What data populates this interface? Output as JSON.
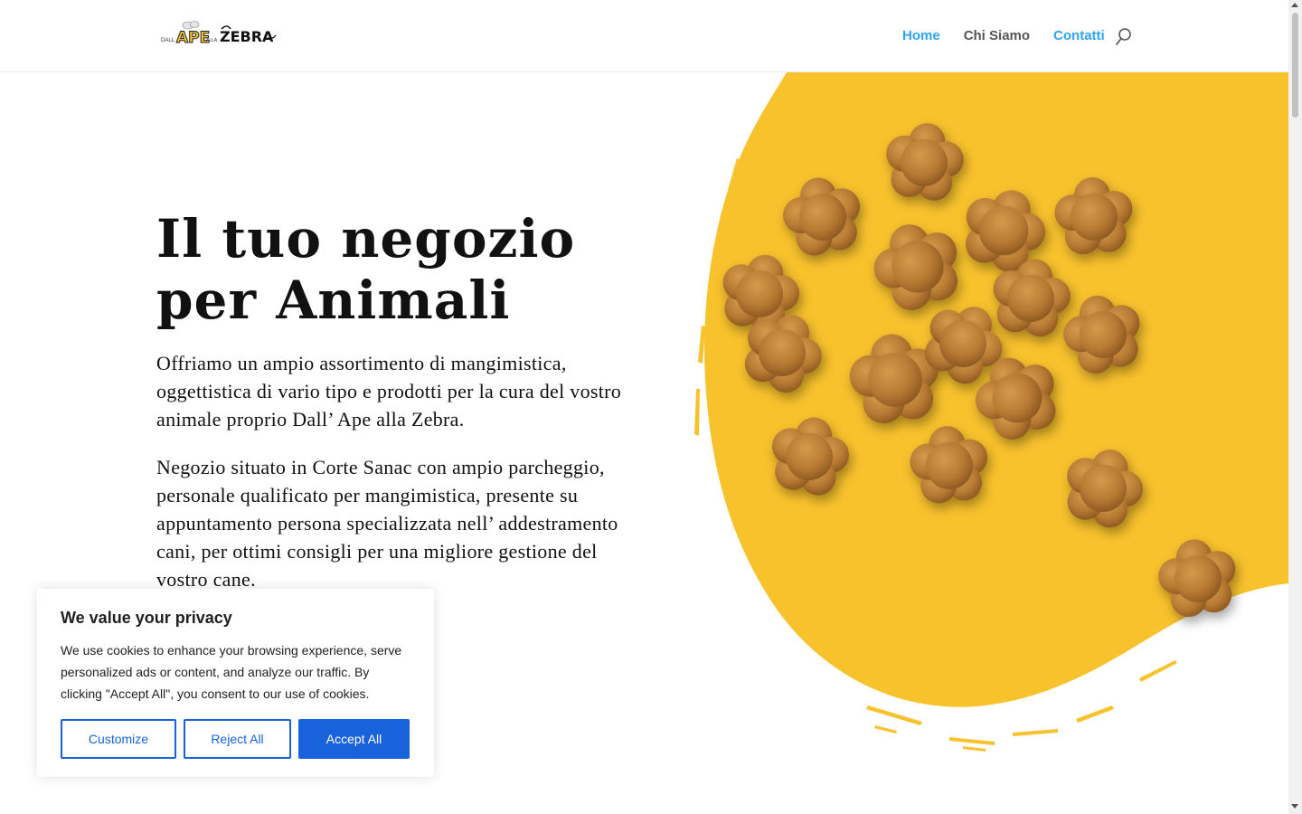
{
  "header": {
    "logo_text": "Dall'Ape alla Zebra",
    "nav": [
      {
        "label": "Home",
        "active": true
      },
      {
        "label": "Chi Siamo",
        "active": false
      },
      {
        "label": "Contatti",
        "active": true
      }
    ],
    "search_icon": "search-icon"
  },
  "hero": {
    "title_line1": "Il tuo negozio",
    "title_line2": "per Animali",
    "paragraph1": "Offriamo un ampio assortimento di mangimistica, oggettistica di vario tipo e prodotti per la cura del vostro animale proprio Dall’ Ape alla Zebra.",
    "paragraph2": "Negozio situato in Corte Sanac con ampio parcheggio, personale qualificato per mangimistica, presente su appuntamento persona specializzata nell’ addestramento cani, per ottimi consigli per una migliore gestione del vostro cane.",
    "image": "dog-biscuits-on-yellow-splash"
  },
  "cookie_banner": {
    "title": "We value your privacy",
    "text": "We use cookies to enhance your browsing experience, serve personalized ads or content, and analyze our traffic. By clicking \"Accept All\", you consent to our use of cookies.",
    "customize_label": "Customize",
    "reject_label": "Reject All",
    "accept_label": "Accept All"
  },
  "colors": {
    "nav_active": "#2ea3f2",
    "nav_inactive": "#555555",
    "accent_yellow": "#f8c22d",
    "cookie_button_blue": "#1863dc"
  }
}
